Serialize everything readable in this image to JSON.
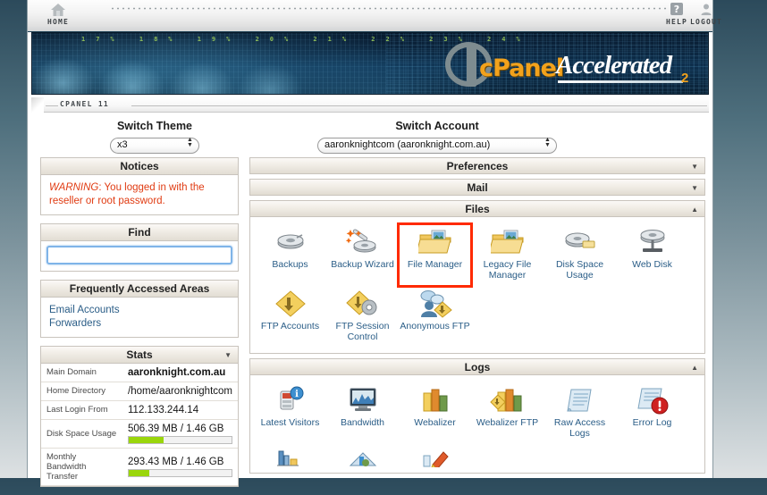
{
  "toolbar": {
    "home": {
      "label": "HOME",
      "icon": "home-icon"
    },
    "help": {
      "label": "HELP",
      "icon": "question-mark-icon"
    },
    "logout": {
      "label": "LOGOUT",
      "icon": "user-icon"
    }
  },
  "banner": {
    "brand_c": "cPanel",
    "brand_accel": "Accelerated",
    "brand_sup": "2",
    "overlay_numbers": "17% 18% 19% 20% 21% 22% 23% 24%"
  },
  "tabstrip": {
    "label": "CPANEL 11"
  },
  "switchers": {
    "theme": {
      "title": "Switch Theme",
      "value": "x3",
      "options": [
        "x3"
      ]
    },
    "account": {
      "title": "Switch Account",
      "value": "aaronknightcom (aaronknight.com.au)",
      "options": [
        "aaronknightcom (aaronknight.com.au)"
      ]
    }
  },
  "sidebar": {
    "notices": {
      "title": "Notices",
      "warning_label": "WARNING",
      "warning_text": ": You logged in with the reseller or root password."
    },
    "find": {
      "title": "Find",
      "value": "",
      "placeholder": ""
    },
    "frequently_accessed": {
      "title": "Frequently Accessed Areas",
      "items": [
        {
          "label": "Email Accounts"
        },
        {
          "label": "Forwarders"
        }
      ]
    },
    "stats": {
      "title": "Stats",
      "caret": "collapse-caret-icon",
      "rows": [
        {
          "key": "Main Domain",
          "value": "aaronknight.com.au",
          "bold": true
        },
        {
          "key": "Home Directory",
          "value": "/home/aaronknightcom",
          "bold": false
        },
        {
          "key": "Last Login From",
          "value": "112.133.244.14",
          "bold": false
        },
        {
          "key": "Disk Space Usage",
          "value": "506.39 MB / 1.46 GB",
          "bold": false,
          "bar_percent": 34
        },
        {
          "key": "Monthly Bandwidth Transfer",
          "value": "293.43 MB / 1.46 GB",
          "bold": false,
          "bar_percent": 20
        }
      ]
    }
  },
  "panels": [
    {
      "title": "Preferences",
      "state": "collapsed",
      "caret": "chevron-down-icon"
    },
    {
      "title": "Mail",
      "state": "collapsed",
      "caret": "chevron-down-icon"
    },
    {
      "title": "Files",
      "state": "expanded",
      "caret": "chevron-up-icon"
    },
    {
      "title": "Logs",
      "state": "expanded",
      "caret": "chevron-up-icon"
    }
  ],
  "files_items_row1": [
    {
      "label": "Backups",
      "icon": "backup-drive-icon",
      "highlighted": false
    },
    {
      "label": "Backup Wizard",
      "icon": "backup-wizard-icon",
      "highlighted": false
    },
    {
      "label": "File Manager",
      "icon": "folder-image-icon",
      "highlighted": true
    },
    {
      "label": "Legacy File Manager",
      "icon": "folder-image-icon",
      "highlighted": false
    },
    {
      "label": "Disk Space Usage",
      "icon": "disk-usage-icon",
      "highlighted": false
    },
    {
      "label": "Web Disk",
      "icon": "web-disk-icon",
      "highlighted": false
    }
  ],
  "files_items_row2": [
    {
      "label": "FTP Accounts",
      "icon": "ftp-diamond-icon",
      "highlighted": false
    },
    {
      "label": "FTP Session Control",
      "icon": "ftp-gear-icon",
      "highlighted": false
    },
    {
      "label": "Anonymous FTP",
      "icon": "anonymous-ftp-icon",
      "highlighted": false
    }
  ],
  "logs_items_row1": [
    {
      "label": "Latest Visitors",
      "icon": "latest-visitors-icon"
    },
    {
      "label": "Bandwidth",
      "icon": "bandwidth-chart-icon"
    },
    {
      "label": "Webalizer",
      "icon": "webalizer-bars-icon"
    },
    {
      "label": "Webalizer FTP",
      "icon": "webalizer-ftp-icon"
    },
    {
      "label": "Raw Access Logs",
      "icon": "raw-access-logs-icon"
    },
    {
      "label": "Error Log",
      "icon": "error-log-icon"
    }
  ],
  "logs_items_row2": [
    {
      "label": "",
      "icon": "analog-stats-icon"
    },
    {
      "label": "",
      "icon": "awstats-icon"
    },
    {
      "label": "",
      "icon": "choose-log-program-icon"
    }
  ],
  "colors": {
    "accent_link": "#2a5d87",
    "warning": "#e03b12",
    "highlight_box": "#ff2a00",
    "progress_bar": "#9ad60b",
    "brand_orange": "#f2a21c",
    "page_bg_top": "#2c4a5b",
    "page_bg_bottom": "#dde1e3"
  }
}
